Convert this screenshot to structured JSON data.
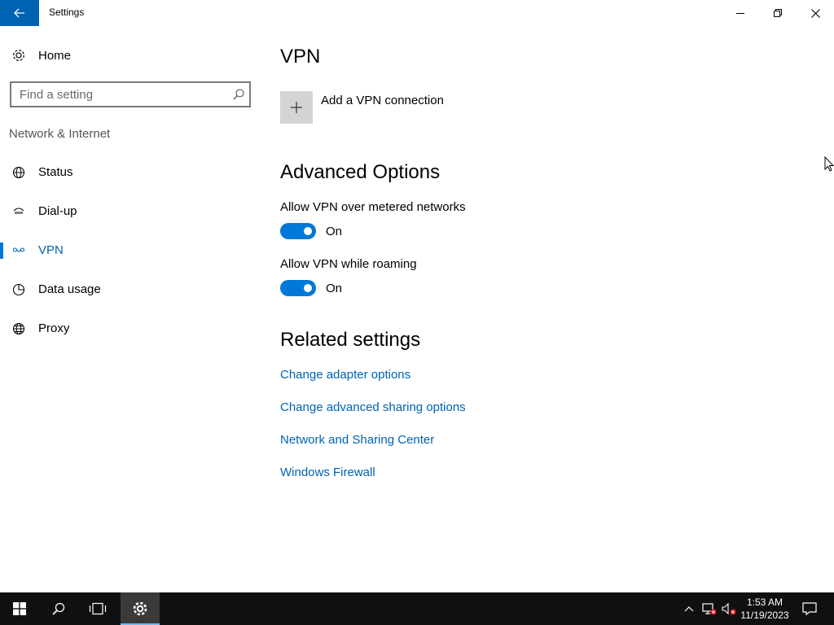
{
  "window": {
    "title": "Settings"
  },
  "sidebar": {
    "home_label": "Home",
    "search_placeholder": "Find a setting",
    "section_title": "Network & Internet",
    "items": [
      {
        "label": "Status",
        "icon": "globe-network-icon"
      },
      {
        "label": "Dial-up",
        "icon": "dialup-icon"
      },
      {
        "label": "VPN",
        "icon": "vpn-icon",
        "active": true
      },
      {
        "label": "Data usage",
        "icon": "data-usage-icon"
      },
      {
        "label": "Proxy",
        "icon": "globe-icon"
      }
    ]
  },
  "main": {
    "title": "VPN",
    "add_vpn_label": "Add a VPN connection",
    "advanced": {
      "title": "Advanced Options",
      "settings": [
        {
          "label": "Allow VPN over metered networks",
          "state": "On",
          "on": true
        },
        {
          "label": "Allow VPN while roaming",
          "state": "On",
          "on": true
        }
      ]
    },
    "related": {
      "title": "Related settings",
      "links": [
        "Change adapter options",
        "Change advanced sharing options",
        "Network and Sharing Center",
        "Windows Firewall"
      ]
    }
  },
  "taskbar": {
    "time": "1:53 AM",
    "date": "11/19/2023"
  },
  "colors": {
    "accent": "#0078d7",
    "link": "#0063b1",
    "taskbar": "#101010"
  }
}
